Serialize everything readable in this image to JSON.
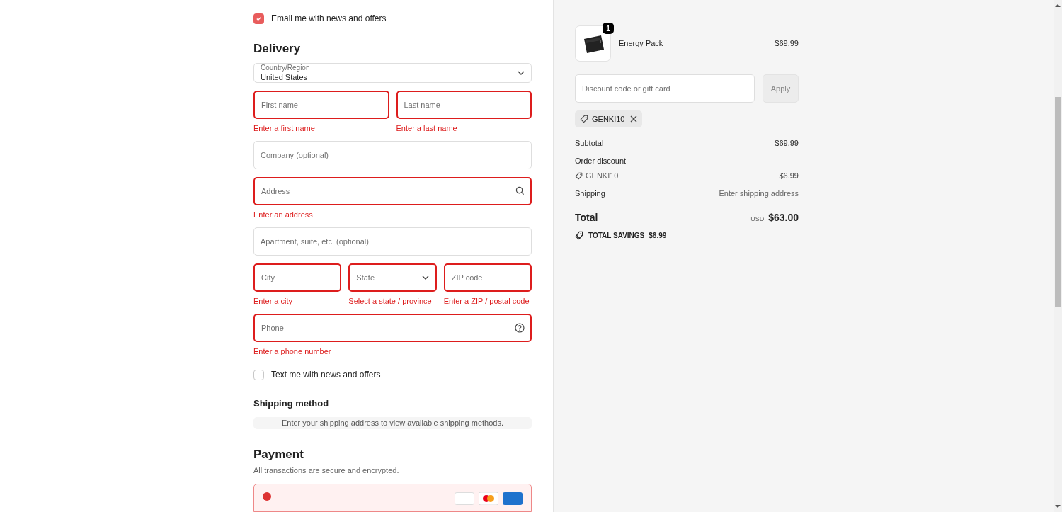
{
  "email_opt_in": {
    "label": "Email me with news and offers",
    "checked": true
  },
  "delivery": {
    "title": "Delivery",
    "country": {
      "label": "Country/Region",
      "value": "United States"
    },
    "rows": [
      [
        {
          "kind": "text",
          "placeholder": "First name",
          "error": "Enter a first name"
        },
        {
          "kind": "text",
          "placeholder": "Last name",
          "error": "Enter a last name"
        }
      ],
      [
        {
          "kind": "text",
          "placeholder": "Company (optional)"
        }
      ],
      [
        {
          "kind": "search",
          "placeholder": "Address",
          "error": "Enter an address"
        }
      ],
      [
        {
          "kind": "text",
          "placeholder": "Apartment, suite, etc. (optional)"
        }
      ],
      [
        {
          "kind": "text",
          "placeholder": "City",
          "error": "Enter a city"
        },
        {
          "kind": "select",
          "placeholder": "State",
          "error": "Select a state / province"
        },
        {
          "kind": "text",
          "placeholder": "ZIP code",
          "error": "Enter a ZIP / postal code"
        }
      ],
      [
        {
          "kind": "help",
          "placeholder": "Phone",
          "error": "Enter a phone number"
        }
      ]
    ]
  },
  "sms_opt_in": {
    "label": "Text me with news and offers",
    "checked": false
  },
  "shipping_method": {
    "title": "Shipping method",
    "message": "Enter your shipping address to view available shipping methods."
  },
  "payment": {
    "title": "Payment",
    "subtitle": "All transactions are secure and encrypted."
  },
  "cart": {
    "item": {
      "name": "Energy Pack",
      "price": "$69.99",
      "quantity": "1"
    },
    "discount": {
      "placeholder": "Discount code or gift card",
      "button": "Apply",
      "applied_code": "GENKI10"
    },
    "subtotal": {
      "label": "Subtotal",
      "value": "$69.99"
    },
    "order_discount": {
      "label": "Order discount",
      "code": "GENKI10",
      "value": "− $6.99"
    },
    "shipping": {
      "label": "Shipping",
      "value": "Enter shipping address"
    },
    "total": {
      "label": "Total",
      "currency": "USD",
      "value": "$63.00"
    },
    "savings": {
      "label": "TOTAL SAVINGS",
      "value": "$6.99"
    }
  }
}
